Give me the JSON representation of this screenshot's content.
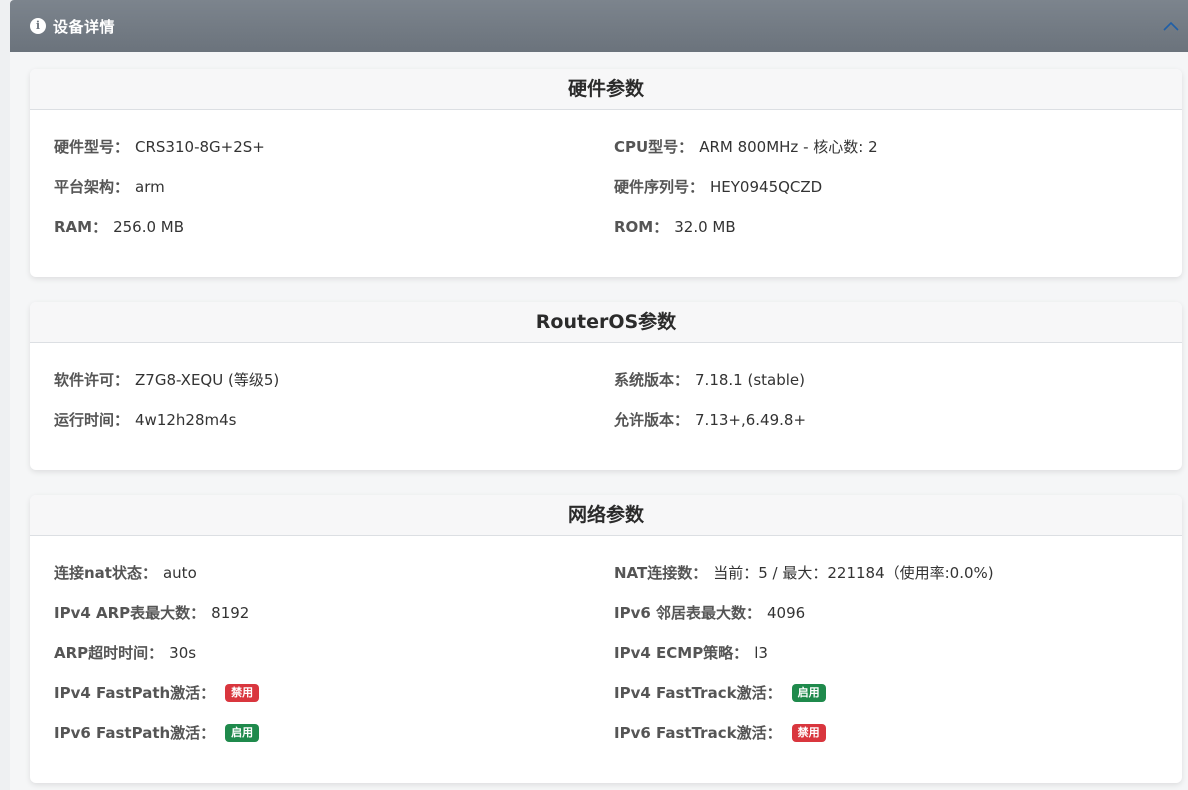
{
  "panel": {
    "title": "设备详情"
  },
  "colors": {
    "enabled": "#1f8a4c",
    "disabled": "#d9363e",
    "header_bar": "#747c85"
  },
  "hardware": {
    "title": "硬件参数",
    "rows": [
      {
        "label": "硬件型号：",
        "value": "CRS310-8G+2S+"
      },
      {
        "label": "CPU型号：",
        "value": "ARM 800MHz - 核心数: 2"
      },
      {
        "label": "平台架构：",
        "value": "arm"
      },
      {
        "label": "硬件序列号：",
        "value": "HEY0945QCZD"
      },
      {
        "label": "RAM：",
        "value": "256.0 MB"
      },
      {
        "label": "ROM：",
        "value": "32.0 MB"
      }
    ]
  },
  "routeros": {
    "title": "RouterOS参数",
    "rows": [
      {
        "label": "软件许可：",
        "value": "Z7G8-XEQU (等级5)"
      },
      {
        "label": "系统版本：",
        "value": "7.18.1 (stable)"
      },
      {
        "label": "运行时间：",
        "value": "4w12h28m4s"
      },
      {
        "label": "允许版本：",
        "value": "7.13+,6.49.8+"
      }
    ]
  },
  "network": {
    "title": "网络参数",
    "rows": [
      {
        "label": "连接nat状态：",
        "value": "auto"
      },
      {
        "label": "NAT连接数：",
        "value": "当前：5 / 最大：221184（使用率:0.0%)"
      },
      {
        "label": "IPv4 ARP表最大数：",
        "value": "8192"
      },
      {
        "label": "IPv6 邻居表最大数：",
        "value": "4096"
      },
      {
        "label": "ARP超时时间：",
        "value": "30s"
      },
      {
        "label": "IPv4 ECMP策略：",
        "value": "l3"
      },
      {
        "label": "IPv4 FastPath激活：",
        "badge": "禁用"
      },
      {
        "label": "IPv4 FastTrack激活：",
        "badge": "启用"
      },
      {
        "label": "IPv6 FastPath激活：",
        "badge": "启用"
      },
      {
        "label": "IPv6 FastTrack激活：",
        "badge": "禁用"
      }
    ]
  }
}
